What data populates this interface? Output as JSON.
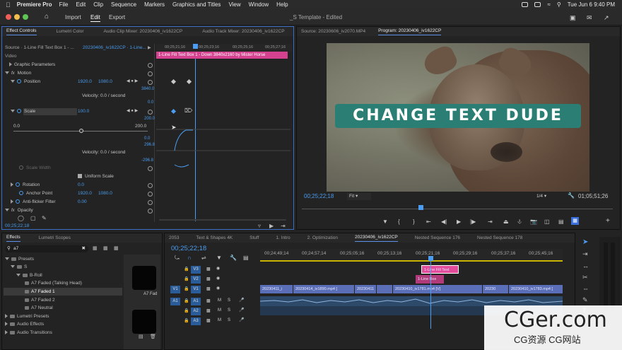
{
  "menubar": {
    "app": "Premiere Pro",
    "items": [
      "File",
      "Edit",
      "Clip",
      "Sequence",
      "Markers",
      "Graphics and Titles",
      "View",
      "Window",
      "Help"
    ],
    "clock": "Tue Jun 6  9:40 PM"
  },
  "header": {
    "import": "Import",
    "edit": "Edit",
    "export": "Export",
    "doc_title": "_S Template - Edited"
  },
  "effect_controls": {
    "tabs": [
      "Effect Controls",
      "Lumetri Color",
      "Audio Clip Mixer: 20230406_iv1622CP",
      "Audio Track Mixer: 20230406_iv1622CP"
    ],
    "source_label": "Source · 1-Line Fill Text Box 1 - ...",
    "seq_label": "20230406_iv1622CP · 1-Line...",
    "ruler": [
      "00;25;21;16",
      "00;25;23;16",
      "00;25;25;16",
      "00;25;27;16"
    ],
    "clip_bar": "1-Line Fill Text Box 1 - Down 3840x2160 by Mister Horse",
    "video_label": "Video",
    "graphic_params": "Graphic Parameters",
    "motion": "Motion",
    "position": {
      "label": "Position",
      "x": "1920.0",
      "y": "1080.0"
    },
    "scale": {
      "label": "Scale",
      "value": "100.0"
    },
    "scale_width": "Scale Width",
    "uniform_scale": "Uniform Scale",
    "rotation": {
      "label": "Rotation",
      "value": "0.0"
    },
    "anchor": {
      "label": "Anchor Point",
      "x": "1920.0",
      "y": "1080.0"
    },
    "antiflicker": {
      "label": "Anti-flicker Filter",
      "value": "0.00"
    },
    "opacity": "Opacity",
    "velocity1": "Velocity: 0.0 / second",
    "velocity2": "Velocity: 0.0 / second",
    "graph_vals": [
      "3840.0",
      "0.0",
      "200.0",
      "0.0",
      "296.8",
      "-296.8"
    ],
    "slider_min": "0.0",
    "slider_max": "200.0",
    "timecode": "00;25;22;18"
  },
  "source_tab": "Source: 20230606_iv2070.MP4",
  "program": {
    "tab": "Program: 20230406_iv1622CP",
    "title_text": "CHANGE TEXT DUDE",
    "timecode": "00;25;22;18",
    "fit": "Fit",
    "resolution": "1/4",
    "duration": "01;05;51;26"
  },
  "effects_panel": {
    "tabs": [
      "Effects",
      "Lumetri Scopes"
    ],
    "search": "a7",
    "tree": [
      "Presets",
      "S",
      "B-Roll",
      "A7 Faded (Talking Head)",
      "A7 Faded 1",
      "A7 Faded 2",
      "A7 Neutral",
      "Lumetri Presets",
      "Audio Effects",
      "Audio Transitions"
    ],
    "preview_label": "A7 Fad"
  },
  "project_bin": {
    "item": "2053"
  },
  "timeline": {
    "tabs": [
      "Text & Shapes 4K",
      "Stuff",
      "1. Intro",
      "2. Optimization",
      "20230406_iv1622CP",
      "Nested Sequence 176",
      "Nested Sequence 178"
    ],
    "timecode": "00;25;22;18",
    "ruler": [
      "00;24;49;14",
      "00;24;57;14",
      "00;25;05;16",
      "00;25;13;16",
      "00;25;21;16",
      "00;25;29;16",
      "00;25;37;16",
      "00;25;45;16"
    ],
    "tracks": [
      "V3",
      "V2",
      "V1",
      "A1",
      "A2",
      "A3"
    ],
    "src_v": "V1",
    "src_a": "A1",
    "clips_v1": [
      "20230411_i",
      "20230414_iv1890.mp4 [",
      "20230411",
      "",
      "20230410_iv1781.mp4 [V]",
      "20230",
      "20230410_iv1783.mp4 ["
    ],
    "clips_v3": "1-Line Fill Text",
    "clips_v2": "1-Line Box"
  },
  "watermark": {
    "big": "CGer.com",
    "small": "CG资源 CG网站"
  }
}
